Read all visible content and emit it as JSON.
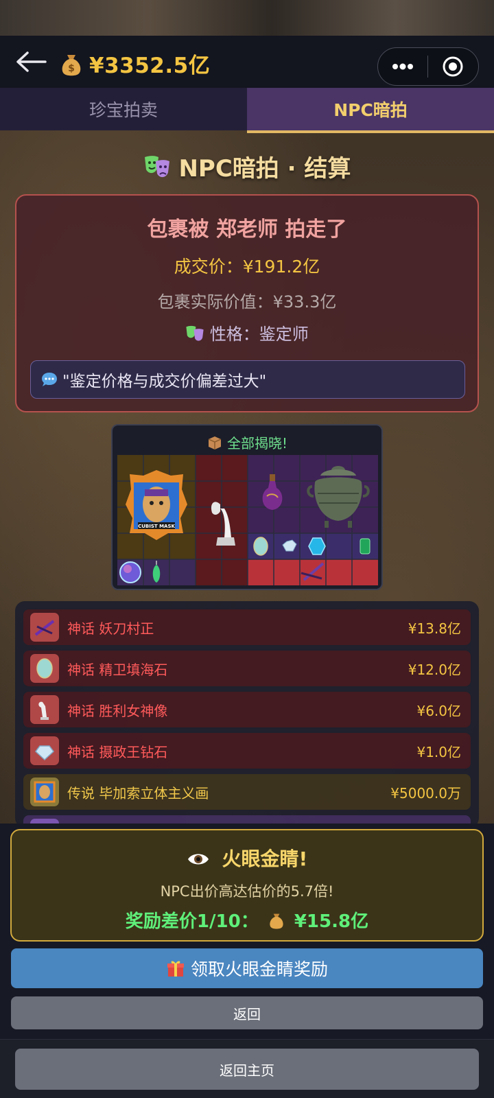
{
  "header": {
    "balance": "¥3352.5亿",
    "back_icon": "back-arrow-icon",
    "money_icon": "money-bag-icon"
  },
  "tabs": [
    {
      "label": "珍宝拍卖",
      "active": false
    },
    {
      "label": "NPC暗拍",
      "active": true
    }
  ],
  "settlement": {
    "title": "NPC暗拍 · 结算",
    "headline": "包裹被 郑老师 拍走了",
    "deal_price": "成交价：¥191.2亿",
    "actual_value": "包裹实际价值：¥33.3亿",
    "persona": "性格：鉴定师",
    "quote": "\"鉴定价格与成交价偏差过大\""
  },
  "reveal": {
    "title": "全部揭晓!",
    "mask_label": "CUBIST MASK"
  },
  "items": [
    {
      "rarity": "myth",
      "name": "神话 妖刀村正",
      "value": "¥13.8亿",
      "icon": "katana-icon"
    },
    {
      "rarity": "myth",
      "name": "神话 精卫填海石",
      "value": "¥12.0亿",
      "icon": "opal-stone-icon"
    },
    {
      "rarity": "myth",
      "name": "神话 胜利女神像",
      "value": "¥6.0亿",
      "icon": "winged-victory-statue-icon"
    },
    {
      "rarity": "myth",
      "name": "神话 摄政王钻石",
      "value": "¥1.0亿",
      "icon": "diamond-icon"
    },
    {
      "rarity": "legend",
      "name": "传说 毕加索立体主义画",
      "value": "¥5000.0万",
      "icon": "cubist-painting-icon"
    }
  ],
  "reward": {
    "title": "火眼金睛!",
    "desc": "NPC出价高达估价的5.7倍!",
    "amount_label": "奖励差价1/10：",
    "amount_value": "¥15.8亿"
  },
  "buttons": {
    "claim": "领取火眼金睛奖励",
    "back": "返回",
    "home": "返回主页"
  },
  "colors": {
    "gold": "#f4c542",
    "myth_red": "#ff5a5a",
    "legend_gold": "#f2c84b",
    "tab_active_bg": "#4a3566",
    "claim_blue": "#4a86c0"
  }
}
